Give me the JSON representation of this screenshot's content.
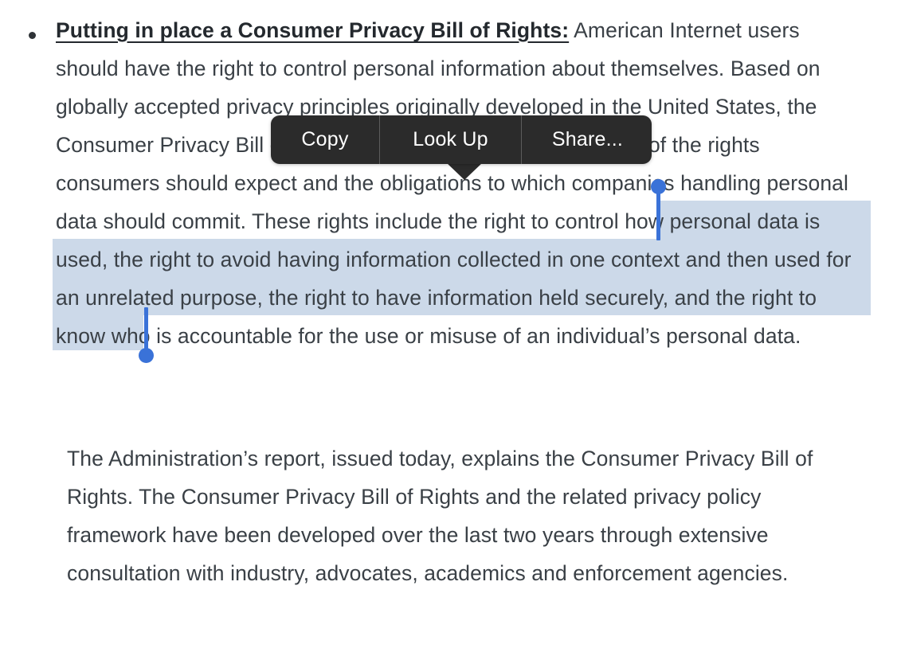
{
  "page": {
    "background_color": "#ffffff",
    "text_color": "#3a4046"
  },
  "bullet": {
    "marker": "•",
    "lead_label": "Putting in place a Consumer Privacy Bill of Rights:",
    "body": " American Internet users should have the right to control personal information about themselves. Based on globally accepted privacy principles originally developed in the United States, the Consumer Privacy Bill of Rights is a comprehensive statement of the rights consumers should expect and the obligations to which companies handling personal data should commit. These rights include the right to control how personal data is used, the right to avoid having information collected in one context and then used for an unrelated purpose, the right to have information held securely, and the right to know who is accountable for the use or misuse of an individual’s personal data."
  },
  "paragraph_2": {
    "text": "The Administration’s report, issued today, explains the Consumer Privacy Bill of Rights. The Consumer Privacy Bill of Rights and the related privacy policy framework have been developed over the last two years through extensive consultation with industry, advocates, academics and enforcement agencies."
  },
  "selection": {
    "selected_text": "These rights include the right to control how personal data is used, the right to avoid having information collected in one context and then used for an unrelated purpose,",
    "highlight_color": "#ccd9e9",
    "handle_color": "#3a72d8"
  },
  "context_menu": {
    "background_color": "#2b2b2b",
    "items": [
      {
        "label": "Copy"
      },
      {
        "label": "Look Up"
      },
      {
        "label": "Share..."
      }
    ]
  }
}
